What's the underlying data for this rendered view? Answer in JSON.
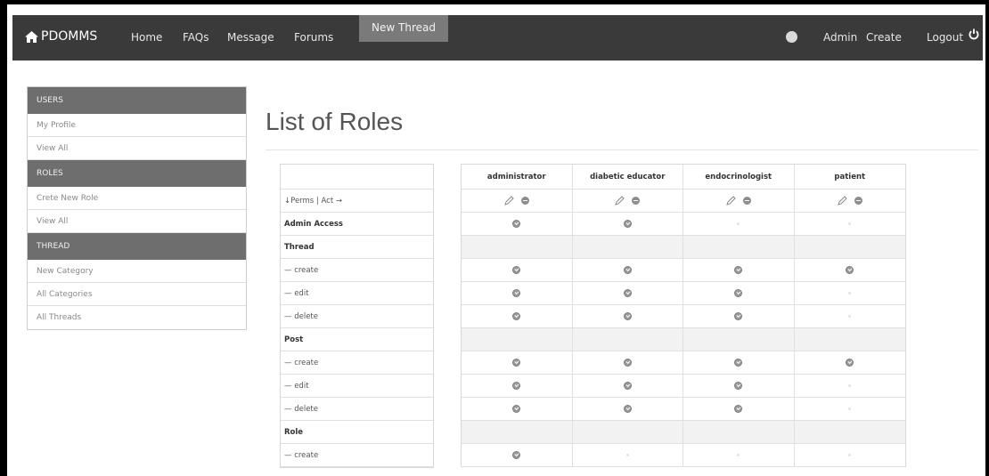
{
  "nav": {
    "brand": "PDOMMS",
    "links": [
      "Home",
      "FAQs",
      "Message",
      "Forums"
    ],
    "active_tab": "New Thread",
    "right_links": [
      "Admin",
      "Create"
    ],
    "logout": "Logout"
  },
  "sidebar": {
    "sections": [
      {
        "title": "USERS",
        "items": [
          "My Profile",
          "View All"
        ]
      },
      {
        "title": "ROLES",
        "items": [
          "Crete New Role",
          "View All"
        ]
      },
      {
        "title": "THREAD",
        "items": [
          "New Category",
          "All Categories",
          "All Threads"
        ]
      }
    ]
  },
  "page_title": "List of Roles",
  "table": {
    "axis_label": "↓Perms | Act →",
    "roles": [
      "administrator",
      "diabetic educator",
      "endocrinologist",
      "patient"
    ],
    "rows": [
      {
        "label": "Admin Access",
        "type": "section-perm",
        "values": [
          true,
          true,
          false,
          false
        ]
      },
      {
        "label": "Thread",
        "type": "section",
        "values": null
      },
      {
        "label": "— create",
        "type": "perm",
        "values": [
          true,
          true,
          true,
          true
        ]
      },
      {
        "label": "— edit",
        "type": "perm",
        "values": [
          true,
          true,
          true,
          false
        ]
      },
      {
        "label": "— delete",
        "type": "perm",
        "values": [
          true,
          true,
          true,
          false
        ]
      },
      {
        "label": "Post",
        "type": "section",
        "values": null
      },
      {
        "label": "— create",
        "type": "perm",
        "values": [
          true,
          true,
          true,
          true
        ]
      },
      {
        "label": "— edit",
        "type": "perm",
        "values": [
          true,
          true,
          true,
          false
        ]
      },
      {
        "label": "— delete",
        "type": "perm",
        "values": [
          true,
          true,
          true,
          false
        ]
      },
      {
        "label": "Role",
        "type": "section",
        "values": null
      },
      {
        "label": "— create",
        "type": "perm",
        "values": [
          true,
          false,
          false,
          false
        ]
      }
    ]
  }
}
